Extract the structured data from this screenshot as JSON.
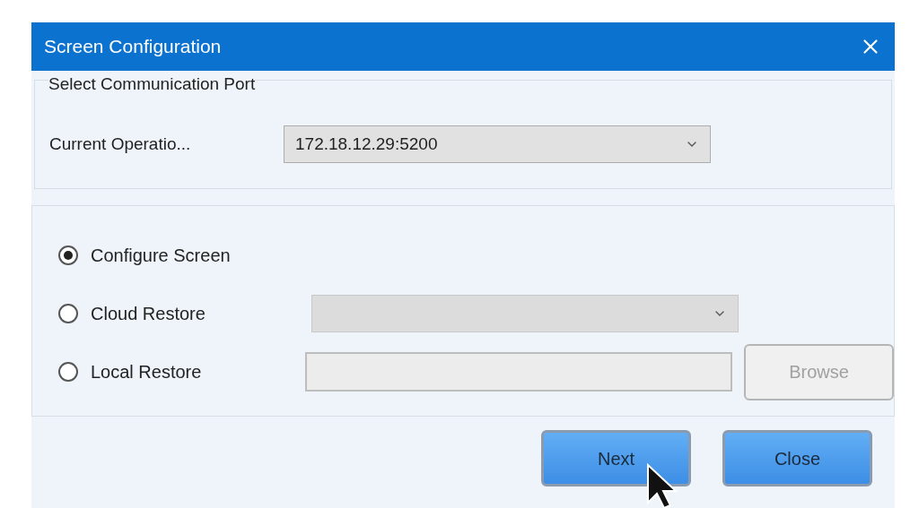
{
  "window": {
    "title": "Screen Configuration"
  },
  "port_group": {
    "title": "Select Communication Port",
    "label": "Current Operatio...",
    "value": "172.18.12.29:5200"
  },
  "modes": [
    {
      "label": "Configure Screen",
      "selected": true,
      "kind": "plain"
    },
    {
      "label": "Cloud Restore",
      "selected": false,
      "kind": "dropdown",
      "disabled": true
    },
    {
      "label": "Local Restore",
      "selected": false,
      "kind": "file",
      "disabled": true,
      "button": {
        "label": "Browse",
        "disabled": true
      }
    }
  ],
  "buttons": [
    {
      "label": "Next",
      "disabled": false
    },
    {
      "label": "Close",
      "disabled": false
    }
  ]
}
